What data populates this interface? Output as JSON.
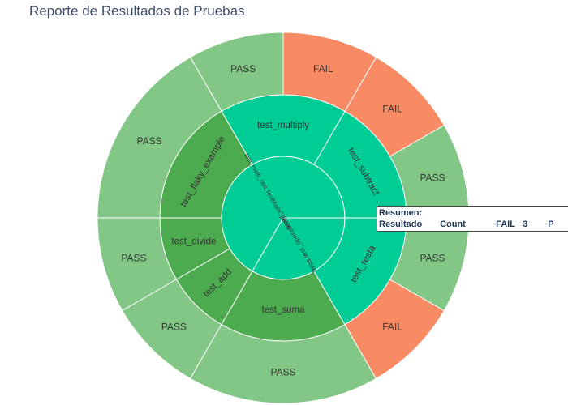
{
  "chart_data": {
    "type": "sunburst",
    "title": "Reporte de Resultados de Pruebas",
    "colors": {
      "class_node": "#00cc96",
      "test_node": "#4dab4f",
      "pass": "#82c785",
      "fail": "#f88a64",
      "border": "#ffffff"
    },
    "nodes": [
      {
        "id": "C1",
        "label": "test_math_ops.TestMathOperati",
        "parent": "",
        "value": 8,
        "kind": "class_node"
      },
      {
        "id": "C2",
        "label": "tests.test_operations",
        "parent": "",
        "value": 4,
        "kind": "class_node"
      },
      {
        "id": "T1",
        "label": "test_subtract",
        "parent": "C1",
        "value": 2,
        "kind": "class_node"
      },
      {
        "id": "T2",
        "label": "test_multiply",
        "parent": "C1",
        "value": 2,
        "kind": "class_node"
      },
      {
        "id": "T3",
        "label": "test_flaky_example",
        "parent": "C1",
        "value": 2,
        "kind": "test_node"
      },
      {
        "id": "T4",
        "label": "test_divide",
        "parent": "C1",
        "value": 1,
        "kind": "test_node"
      },
      {
        "id": "T5",
        "label": "test_add",
        "parent": "C1",
        "value": 1,
        "kind": "test_node"
      },
      {
        "id": "T6",
        "label": "test_suma",
        "parent": "C2",
        "value": 2,
        "kind": "test_node"
      },
      {
        "id": "T7",
        "label": "test_resta",
        "parent": "C2",
        "value": 2,
        "kind": "class_node"
      },
      {
        "id": "L1",
        "label": "PASS",
        "parent": "T1",
        "value": 1,
        "kind": "pass"
      },
      {
        "id": "L2",
        "label": "FAIL",
        "parent": "T1",
        "value": 1,
        "kind": "fail"
      },
      {
        "id": "L3",
        "label": "FAIL",
        "parent": "T2",
        "value": 1,
        "kind": "fail"
      },
      {
        "id": "L4",
        "label": "PASS",
        "parent": "T2",
        "value": 1,
        "kind": "pass"
      },
      {
        "id": "L5",
        "label": "PASS",
        "parent": "T3",
        "value": 2,
        "kind": "pass"
      },
      {
        "id": "L6",
        "label": "PASS",
        "parent": "T4",
        "value": 1,
        "kind": "pass"
      },
      {
        "id": "L7",
        "label": "PASS",
        "parent": "T5",
        "value": 1,
        "kind": "pass"
      },
      {
        "id": "L8",
        "label": "PASS",
        "parent": "T6",
        "value": 2,
        "kind": "pass"
      },
      {
        "id": "L9",
        "label": "FAIL",
        "parent": "T7",
        "value": 1,
        "kind": "fail"
      },
      {
        "id": "L10",
        "label": "PASS",
        "parent": "T7",
        "value": 1,
        "kind": "pass"
      }
    ]
  },
  "summary": {
    "title": "Resumen:",
    "header_resultado": "Resultado",
    "header_count": "Count",
    "fail_label": "FAIL",
    "fail_count": "3",
    "pass_label": "P"
  }
}
